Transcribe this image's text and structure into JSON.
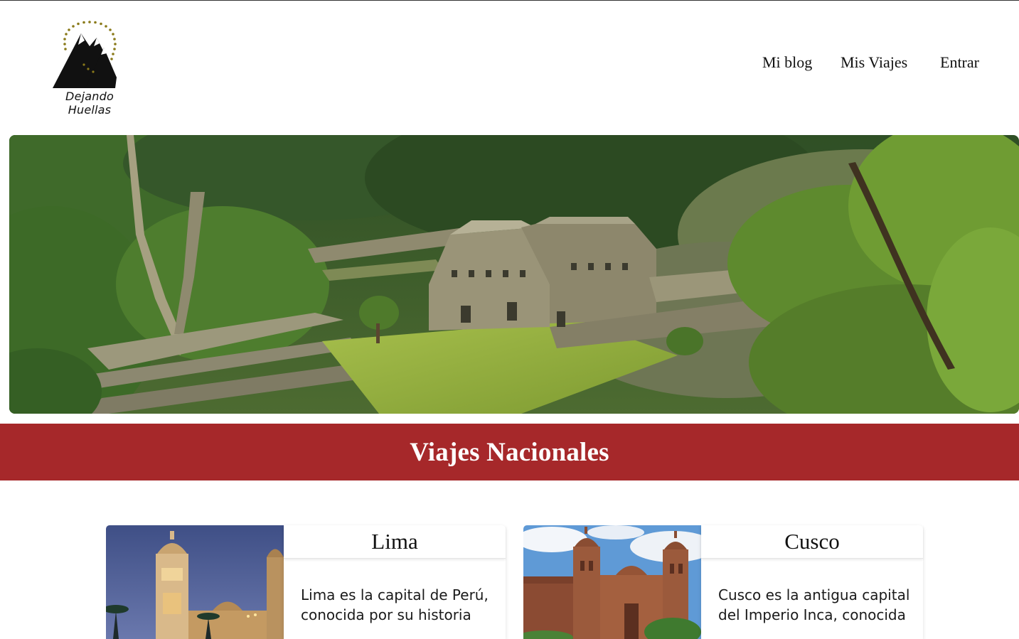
{
  "logo": {
    "caption": "Dejando Huellas",
    "icon": "mountain-logo-icon",
    "accent_color": "#8a7a1a"
  },
  "nav": {
    "items": [
      {
        "label": "Mi blog"
      },
      {
        "label": "Mis Viajes"
      },
      {
        "label": "Entrar"
      }
    ]
  },
  "banner": {
    "heading": "Viajes Nacionales",
    "color": "#a6282a"
  },
  "cards": [
    {
      "title": "Lima",
      "description": "Lima es la capital de Perú, conocida por su historia"
    },
    {
      "title": "Cusco",
      "description": "Cusco es la antigua capital del Imperio Inca, conocida"
    }
  ]
}
